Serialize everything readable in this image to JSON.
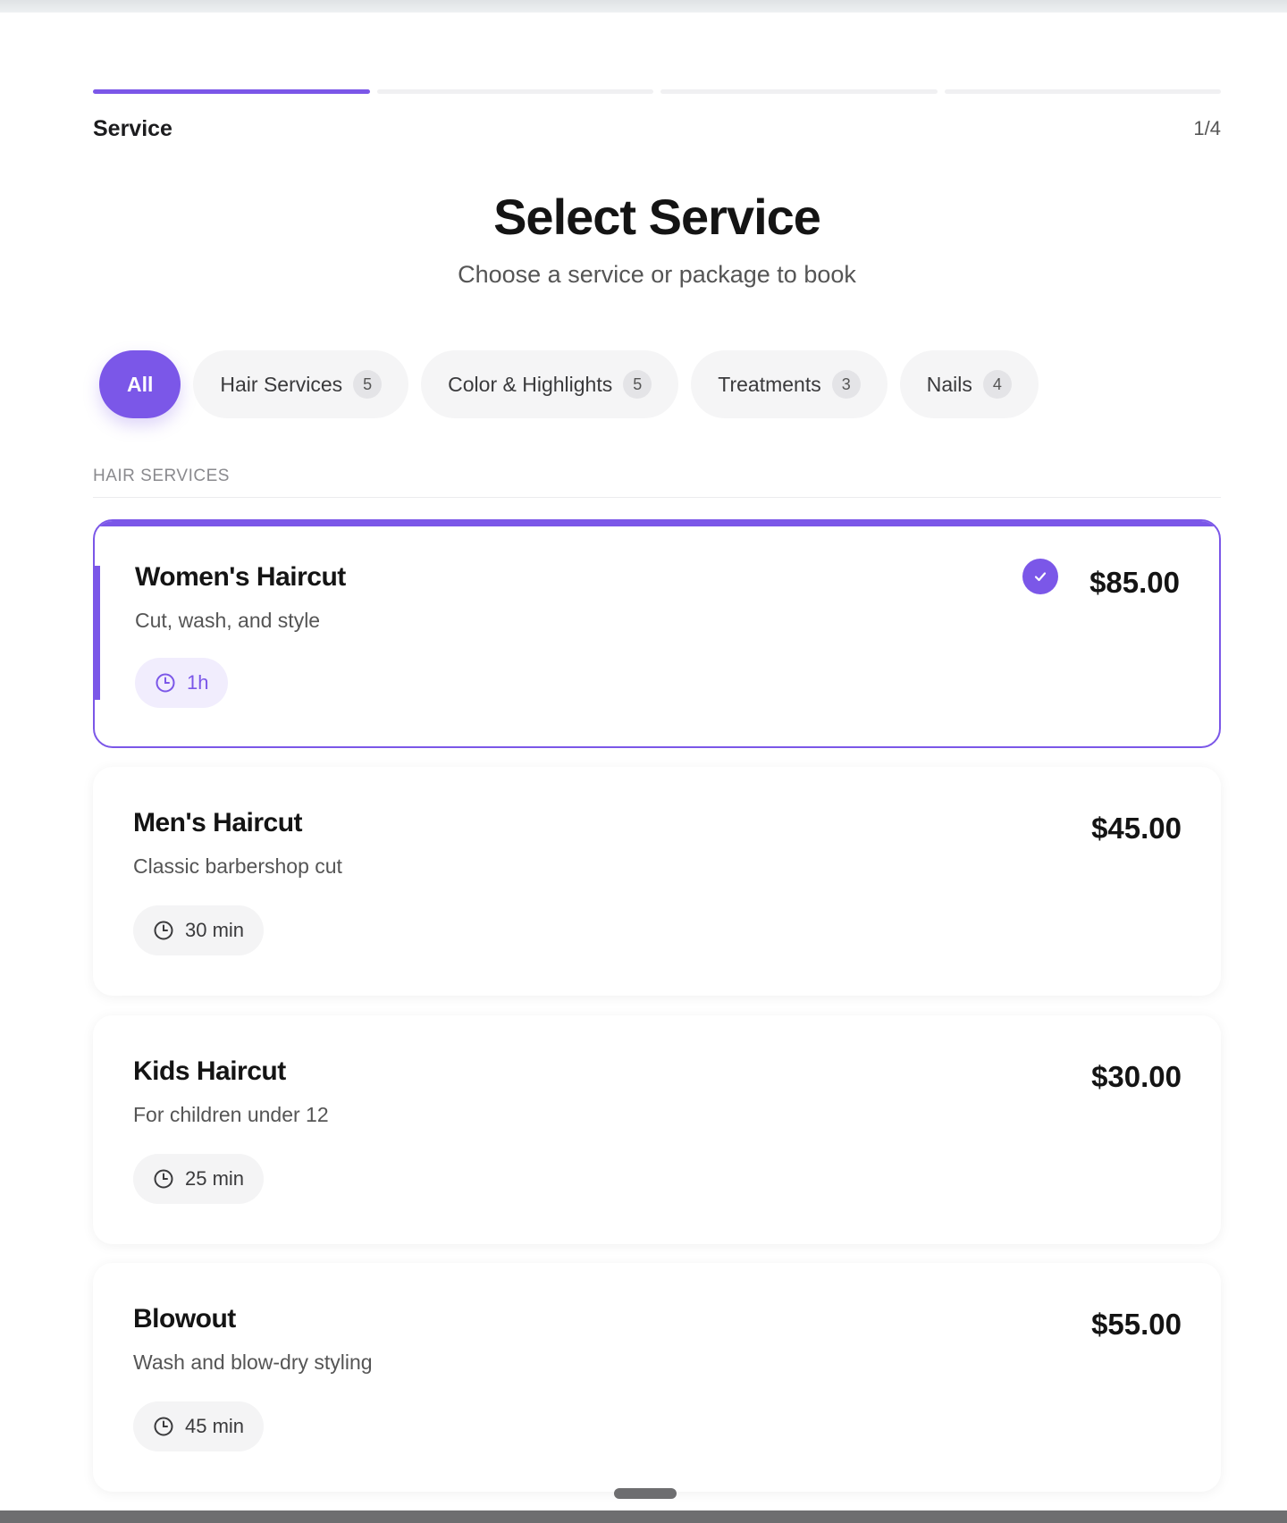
{
  "progress": {
    "current_step": 1,
    "total_steps": 4
  },
  "step": {
    "label": "Service",
    "count": "1/4"
  },
  "header": {
    "title": "Select Service",
    "subtitle": "Choose a service or package to book"
  },
  "filters": [
    {
      "label": "All",
      "count": ""
    },
    {
      "label": "Hair Services",
      "count": "5"
    },
    {
      "label": "Color & Highlights",
      "count": "5"
    },
    {
      "label": "Treatments",
      "count": "3"
    },
    {
      "label": "Nails",
      "count": "4"
    }
  ],
  "section": {
    "title": "HAIR SERVICES"
  },
  "services": [
    {
      "name": "Women's Haircut",
      "desc": "Cut, wash, and style",
      "duration": "1h",
      "price": "$85.00",
      "selected": true
    },
    {
      "name": "Men's Haircut",
      "desc": "Classic barbershop cut",
      "duration": "30 min",
      "price": "$45.00",
      "selected": false
    },
    {
      "name": "Kids Haircut",
      "desc": "For children under 12",
      "duration": "25 min",
      "price": "$30.00",
      "selected": false
    },
    {
      "name": "Blowout",
      "desc": "Wash and blow-dry styling",
      "duration": "45 min",
      "price": "$55.00",
      "selected": false
    }
  ],
  "colors": {
    "accent": "#7b57e8",
    "accent_light": "#f1edfd"
  },
  "icons": {
    "duration": "clock-icon",
    "selected": "checkmark-icon"
  }
}
